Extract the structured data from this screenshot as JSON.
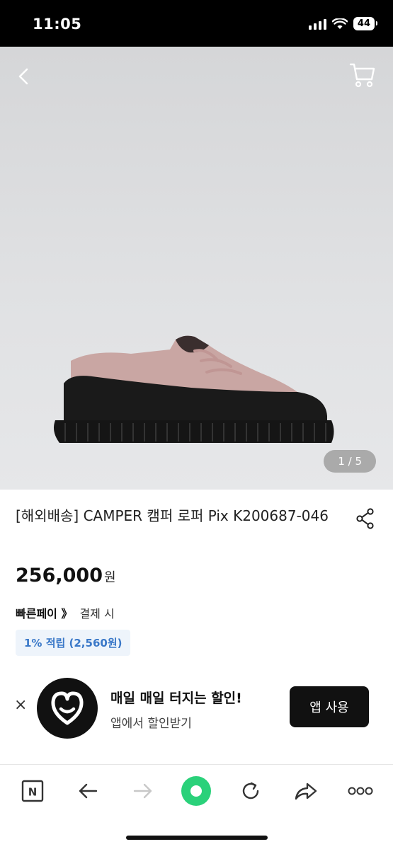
{
  "status_bar": {
    "time": "11:05",
    "battery": "44"
  },
  "product": {
    "image_index": "1 / 5",
    "title": "[해외배송] CAMPER 캠퍼 로퍼 Pix K200687-046",
    "price": "256,000",
    "currency": "원",
    "pay_brand": "빠른페이 》",
    "pay_text": "결제 시",
    "reward": "1% 적립 (2,560원)"
  },
  "banner": {
    "close": "×",
    "headline": "매일 매일 터지는 할인!",
    "sub": "앱에서 할인받기",
    "button": "앱 사용"
  },
  "bottom_bar": {
    "naver": "N",
    "more": "ooo"
  },
  "colors": {
    "reward_text": "#3a78c8",
    "reward_bg": "#eef4fb",
    "green_button": "#2ad17a"
  },
  "icons": [
    "back-icon",
    "cart-icon",
    "share-icon",
    "naver-n-icon",
    "arrow-left-icon",
    "arrow-right-icon",
    "green-dot-icon",
    "reload-icon",
    "share-arrow-icon",
    "more-icon",
    "heart-b-logo-icon",
    "close-icon"
  ]
}
